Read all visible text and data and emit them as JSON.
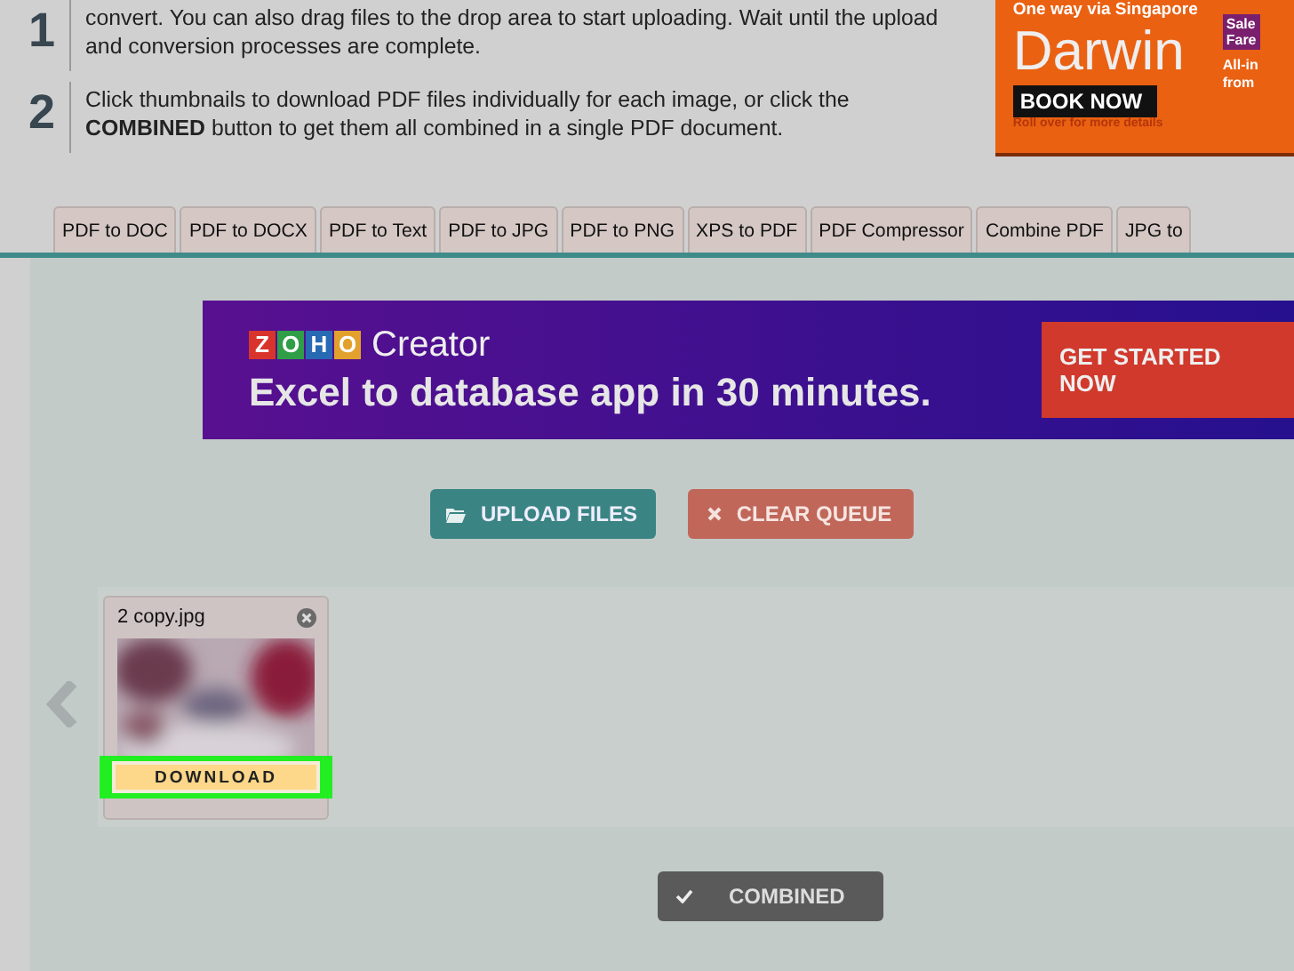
{
  "steps": [
    {
      "number": "1",
      "text": "convert. You can also drag files to the drop area to start uploading. Wait until the upload and conversion processes are complete."
    },
    {
      "number": "2",
      "text": "Click thumbnails to download PDF files individually for each image, or click the **COMBINED** button to get them all combined in a single PDF document."
    }
  ],
  "top_ad": {
    "tagline": "One way via Singapore",
    "destination": "Darwin",
    "button": "BOOK NOW",
    "note": "Roll over for more details",
    "side_badge": [
      "Sale",
      "Fare"
    ],
    "side_text": [
      "All-in",
      "from"
    ]
  },
  "tabs": [
    {
      "label": "PDF to DOC",
      "selected": false
    },
    {
      "label": "PDF to DOCX",
      "selected": false
    },
    {
      "label": "PDF to Text",
      "selected": false
    },
    {
      "label": "PDF to JPG",
      "selected": false
    },
    {
      "label": "PDF to PNG",
      "selected": false
    },
    {
      "label": "XPS to PDF",
      "selected": false
    },
    {
      "label": "PDF Compressor",
      "selected": false
    },
    {
      "label": "Combine PDF",
      "selected": false
    },
    {
      "label": "JPG to",
      "selected": false
    }
  ],
  "banner_ad": {
    "logo_letters": [
      "Z",
      "O",
      "H",
      "O"
    ],
    "product": "Creator",
    "headline": "Excel to database app in 30 minutes.",
    "button": "GET STARTED NOW"
  },
  "actions": [
    {
      "kind": "upload",
      "label": "UPLOAD FILES"
    },
    {
      "kind": "clear",
      "label": "CLEAR QUEUE"
    }
  ],
  "files": [
    {
      "name": "2 copy.jpg",
      "button": "DOWNLOAD",
      "highlighted": true
    }
  ],
  "combined_button": "COMBINED"
}
